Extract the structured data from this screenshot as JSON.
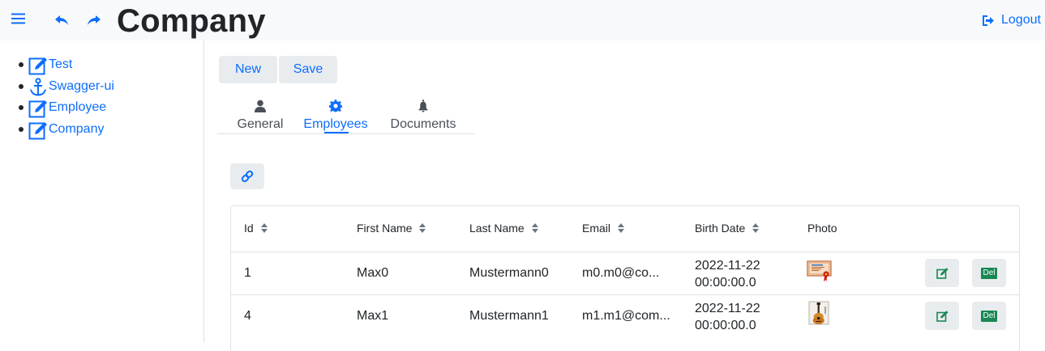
{
  "header": {
    "title": "Company",
    "menu_icon": "hamburger-icon",
    "undo_icon": "undo-icon",
    "redo_icon": "redo-icon",
    "logout_label": "Logout",
    "accent_color": "#0d6efd"
  },
  "sidebar": {
    "items": [
      {
        "label": "Test",
        "icon": "edit-icon"
      },
      {
        "label": "Swagger-ui",
        "icon": "anchor-icon"
      },
      {
        "label": "Employee",
        "icon": "edit-icon"
      },
      {
        "label": "Company",
        "icon": "edit-icon"
      }
    ]
  },
  "toolbar": {
    "new_label": "New",
    "save_label": "Save"
  },
  "tabs": [
    {
      "label": "General",
      "icon": "user-icon",
      "active": false
    },
    {
      "label": "Employees",
      "icon": "gear-icon",
      "active": true
    },
    {
      "label": "Documents",
      "icon": "bell-icon",
      "active": false
    }
  ],
  "link_button": {
    "icon": "link-icon"
  },
  "table": {
    "columns": [
      "Id",
      "First Name",
      "Last Name",
      "Email",
      "Birth Date",
      "Photo"
    ],
    "rows": [
      {
        "id": "1",
        "first_name": "Max0",
        "last_name": "Mustermann0",
        "email": "m0.m0@co...",
        "birth_date_1": "2022-11-22",
        "birth_date_2": "00:00:00.0",
        "photo_icon": "certificate-icon",
        "edit_icon": "edit-icon",
        "delete_label": "Del"
      },
      {
        "id": "4",
        "first_name": "Max1",
        "last_name": "Mustermann1",
        "email": "m1.m1@com...",
        "birth_date_1": "2022-11-22",
        "birth_date_2": "00:00:00.0",
        "photo_icon": "guitar-icon",
        "edit_icon": "edit-icon",
        "delete_label": "Del"
      }
    ]
  }
}
